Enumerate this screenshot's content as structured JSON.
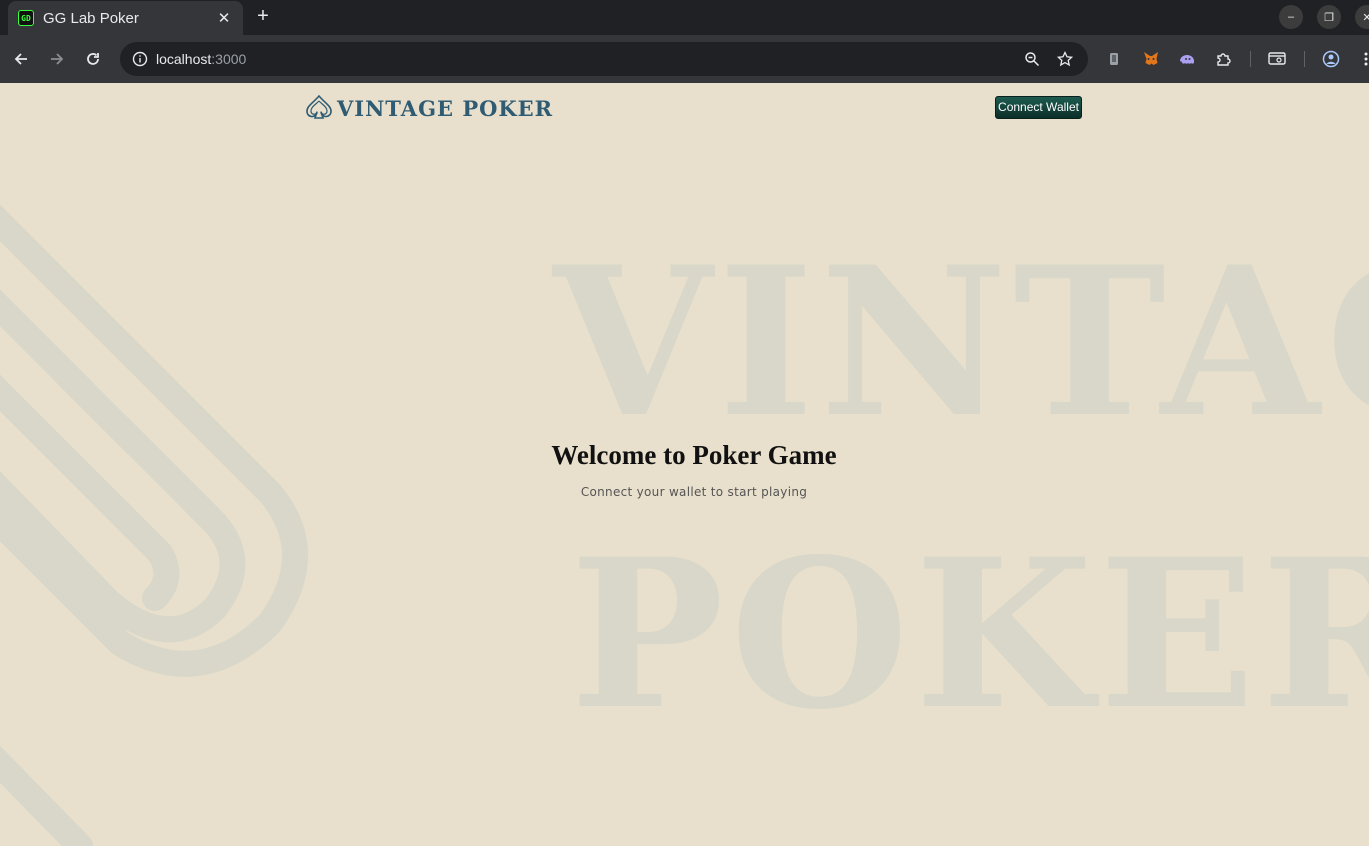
{
  "browser": {
    "tab_title": "GG Lab Poker",
    "tab_favicon_text": "GD",
    "tab_close": "✕",
    "new_tab": "+",
    "url_host": "localhost",
    "url_port": ":3000",
    "window_controls": {
      "minimize": "–",
      "restore": "❐",
      "close": "✕"
    }
  },
  "header": {
    "logo_text": "VINTAGE POKER",
    "connect_label": "Connect Wallet"
  },
  "background": {
    "line1": "VINTAG",
    "line2": "POKER"
  },
  "main": {
    "title": "Welcome to Poker Game",
    "subtitle": "Connect your wallet to start playing"
  },
  "colors": {
    "page_bg": "#e8e0cc",
    "accent": "#2f5b73",
    "button_bg": "#0c2f29",
    "watermark": "#d8d7c9"
  }
}
